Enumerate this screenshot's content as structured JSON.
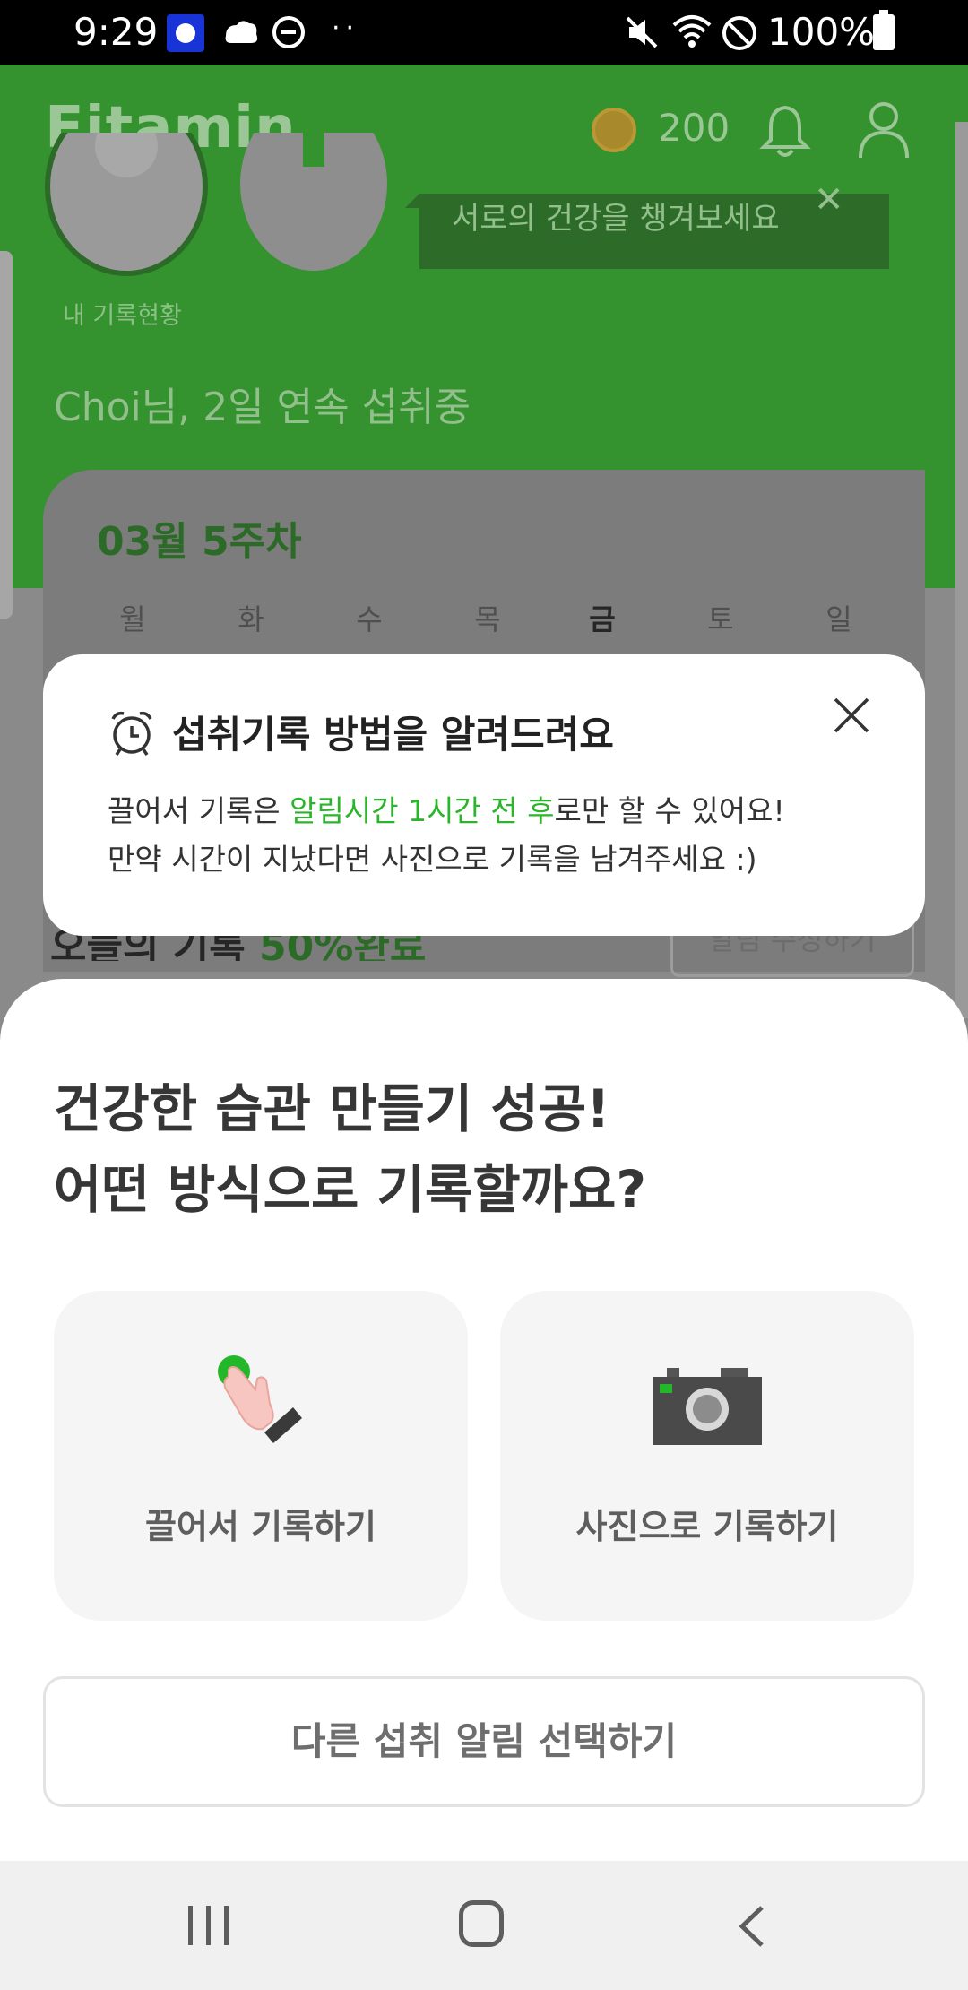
{
  "status_bar": {
    "time": "9:29",
    "battery": "100%",
    "dots": "··"
  },
  "app": {
    "brand": "Fitamin",
    "coins": "200",
    "my_record_label": "내 기록현황",
    "tooltip": "서로의 건강을 챙겨보세요",
    "tooltip_close": "✕",
    "streak": "Choi님, 2일 연속 섭취중",
    "week_title": "03월 5주차",
    "weekdays": [
      "월",
      "화",
      "수",
      "목",
      "금",
      "토",
      "일"
    ],
    "today_label": "오늘의 기록",
    "today_percent": "50%완료",
    "alarm_edit": "알림 수정하기"
  },
  "info_popup": {
    "title": "섭취기록 방법을 알려드려요",
    "line1_a": "끌어서 기록은 ",
    "line1_highlight": "알림시간 1시간 전 후",
    "line1_b": "로만 할 수 있어요!",
    "line2": "만약 시간이 지났다면 사진으로 기록을 남겨주세요 :)"
  },
  "sheet": {
    "title_line1": "건강한 습관 만들기 성공!",
    "title_line2": "어떤 방식으로 기록할까요?",
    "option_drag": "끌어서 기록하기",
    "option_photo": "사진으로 기록하기",
    "other_button": "다른 섭취 알림 선택하기"
  },
  "colors": {
    "brand_green": "#34932f",
    "highlight_green": "#2bb52a"
  }
}
